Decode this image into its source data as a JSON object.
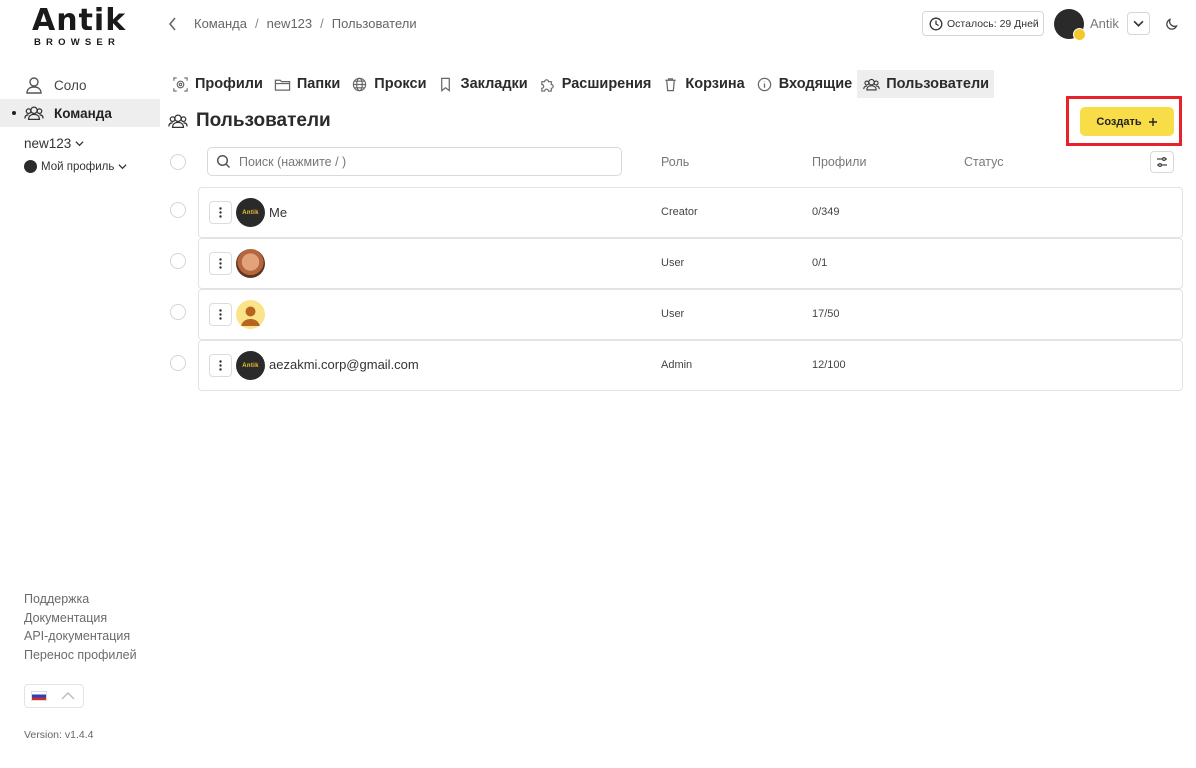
{
  "brand": {
    "name": "Antik",
    "subtitle": "BROWSER"
  },
  "sidebar": {
    "items": [
      {
        "label": "Соло",
        "icon": "user-icon",
        "active": false
      },
      {
        "label": "Команда",
        "icon": "team-icon",
        "active": true
      }
    ],
    "team_selector": "new123",
    "profile_selector": "Мой профиль",
    "links": [
      "Поддержка",
      "Документация",
      "API-документация",
      "Перенос профилей"
    ],
    "language_flag": "russian-flag-icon",
    "version": "Version: v1.4.4"
  },
  "header": {
    "breadcrumb": [
      "Команда",
      "new123",
      "Пользователи"
    ],
    "days_left": "Осталось: 29 Дней",
    "user_name": "Antik"
  },
  "tabs": [
    {
      "label": "Профили",
      "icon": "fingerprint-icon",
      "active": false
    },
    {
      "label": "Папки",
      "icon": "folder-icon",
      "active": false
    },
    {
      "label": "Прокси",
      "icon": "globe-icon",
      "active": false
    },
    {
      "label": "Закладки",
      "icon": "bookmark-icon",
      "active": false
    },
    {
      "label": "Расширения",
      "icon": "puzzle-icon",
      "active": false
    },
    {
      "label": "Корзина",
      "icon": "trash-icon",
      "active": false
    },
    {
      "label": "Входящие",
      "icon": "info-icon",
      "active": false
    },
    {
      "label": "Пользователи",
      "icon": "team-icon",
      "active": true
    }
  ],
  "page": {
    "title": "Пользователи",
    "create_button": "Создать",
    "search_placeholder": "Поиск (нажмите / )",
    "columns": {
      "role": "Роль",
      "profiles": "Профили",
      "status": "Статус"
    }
  },
  "users": [
    {
      "name": "Me",
      "role": "Creator",
      "profiles": "0/349",
      "avatar": "antik-logo"
    },
    {
      "name": "",
      "role": "User",
      "profiles": "0/1",
      "avatar": "photo"
    },
    {
      "name": "",
      "role": "User",
      "profiles": "17/50",
      "avatar": "default-user"
    },
    {
      "name": "aezakmi.corp@gmail.com",
      "role": "Admin",
      "profiles": "12/100",
      "avatar": "antik-logo"
    }
  ],
  "colors": {
    "accent": "#f8dc48",
    "highlight": "#e8212b",
    "active_bg": "#eeeeee"
  }
}
